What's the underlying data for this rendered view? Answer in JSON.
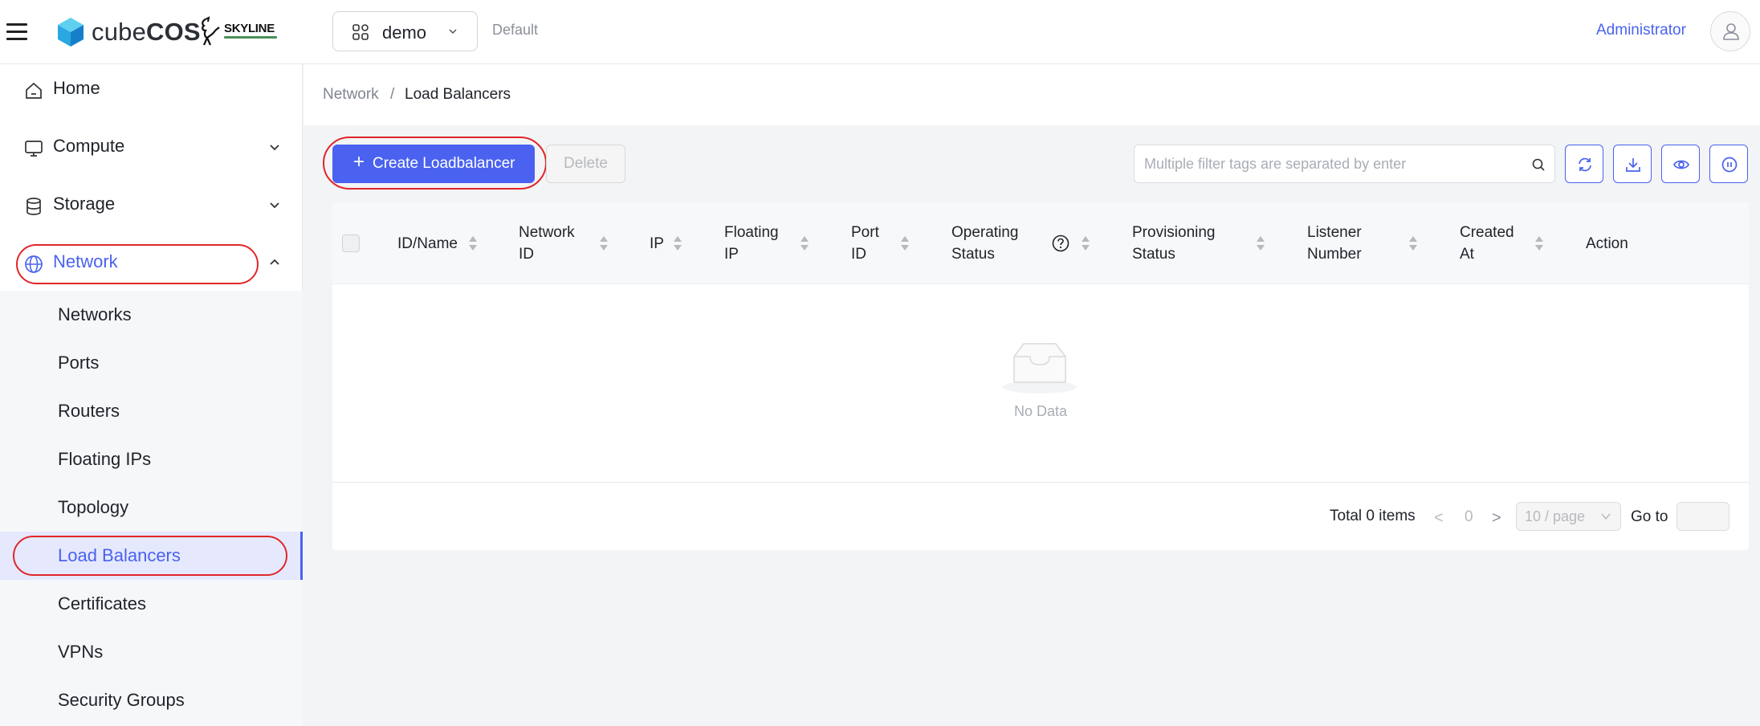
{
  "header": {
    "brand_light": "cube",
    "brand_bold": "COS",
    "skyline_text": "SKYLINE",
    "project": "demo",
    "domain": "Default",
    "user": "Administrator"
  },
  "sidebar": {
    "items": [
      {
        "label": "Home",
        "icon": "home-icon"
      },
      {
        "label": "Compute",
        "icon": "monitor-icon"
      },
      {
        "label": "Storage",
        "icon": "database-icon"
      },
      {
        "label": "Network",
        "icon": "globe-icon"
      }
    ],
    "network_sub": [
      "Networks",
      "Ports",
      "Routers",
      "Floating IPs",
      "Topology",
      "Load Balancers",
      "Certificates",
      "VPNs",
      "Security Groups"
    ],
    "selected": "Load Balancers"
  },
  "breadcrumb": {
    "parent": "Network",
    "separator": "/",
    "current": "Load Balancers"
  },
  "toolbar": {
    "create_label": "Create Loadbalancer",
    "create_icon": "+",
    "delete_label": "Delete",
    "search_placeholder": "Multiple filter tags are separated by enter",
    "tools": [
      "refresh-icon",
      "download-icon",
      "eye-icon",
      "pause-icon"
    ]
  },
  "table": {
    "columns": [
      "ID/Name",
      "Network\nID",
      "IP",
      "Floating\nIP",
      "Port\nID",
      "Operating\nStatus",
      "Provisioning\nStatus",
      "Listener\nNumber",
      "Created\nAt",
      "Action"
    ],
    "rows": [],
    "empty_text": "No Data"
  },
  "pagination": {
    "total": "Total 0 items",
    "prev": "<",
    "current": "0",
    "next": ">",
    "page_size": "10 / page",
    "goto_label": "Go to",
    "goto_value": ""
  },
  "colors": {
    "accent": "#4a62ef",
    "highlight_ring": "#e0262a"
  }
}
